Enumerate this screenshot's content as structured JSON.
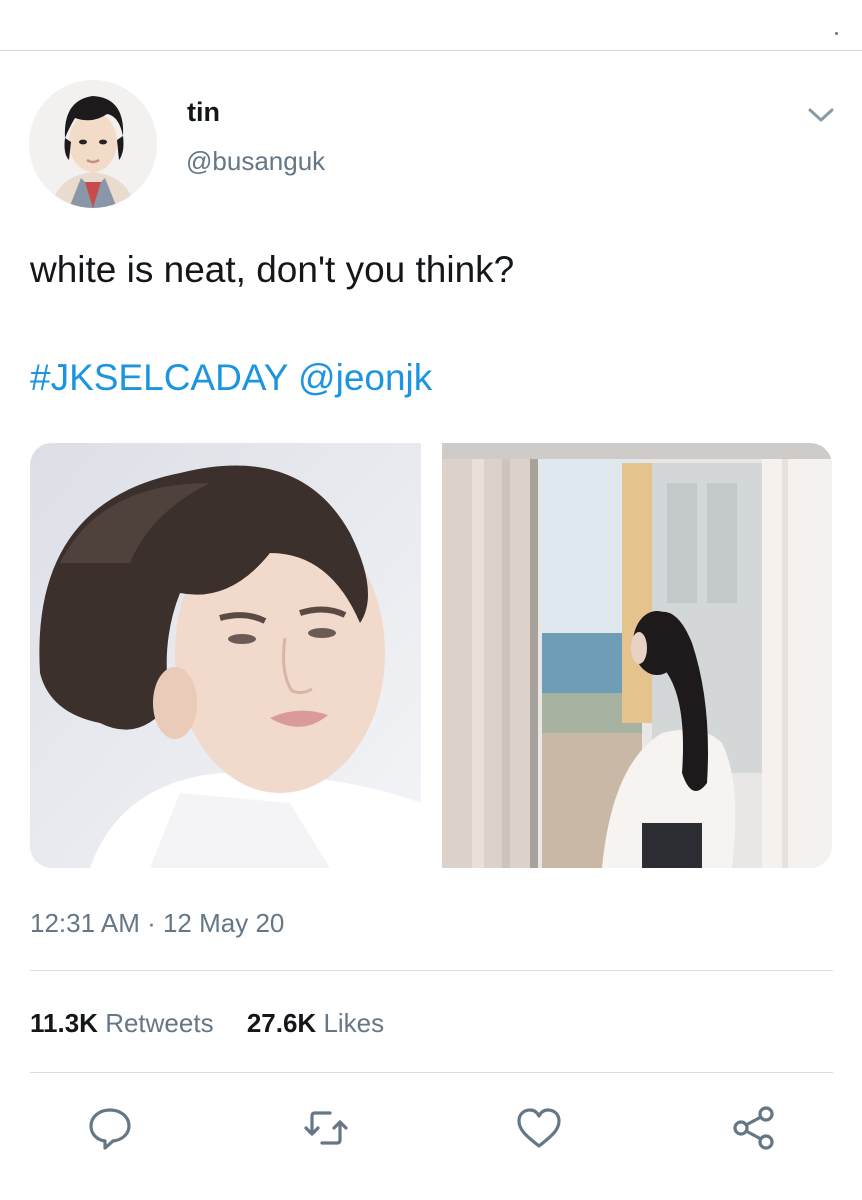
{
  "user": {
    "display_name": "tin",
    "handle": "@busanguk"
  },
  "tweet": {
    "text": "white is neat, don't you think?",
    "hashtag": "#JKSELCADAY",
    "mention": "@jeonjk",
    "timestamp": "12:31 AM · 12 May 20"
  },
  "stats": {
    "retweets_count": "11.3K",
    "retweets_label": "Retweets",
    "likes_count": "27.6K",
    "likes_label": "Likes"
  },
  "actions": [
    "reply-icon",
    "retweet-icon",
    "like-icon",
    "share-icon"
  ],
  "colors": {
    "link": "#1b95e0",
    "secondary_text": "#657786",
    "primary_text": "#14171a",
    "divider": "#d8dee2"
  }
}
